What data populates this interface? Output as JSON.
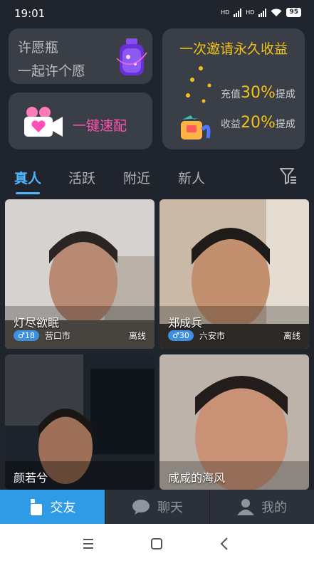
{
  "status_bar": {
    "time": "19:01",
    "network1": "HD",
    "network2": "HD",
    "battery": "95"
  },
  "wish_card": {
    "title": "许愿瓶",
    "subtitle": "一起许个愿"
  },
  "match_card": {
    "label": "一键速配"
  },
  "invite_card": {
    "title": "一次邀请永久收益",
    "recharge_prefix": "充值",
    "recharge_pct": "30%",
    "recharge_suffix": "提成",
    "income_prefix": "收益",
    "income_pct": "20%",
    "income_suffix": "提成"
  },
  "tabs": [
    {
      "label": "真人",
      "active": true
    },
    {
      "label": "活跃"
    },
    {
      "label": "附近"
    },
    {
      "label": "新人"
    }
  ],
  "cards": [
    {
      "name": "灯尽欲眠",
      "age": "18",
      "gender_symbol": "♂",
      "city": "营口市",
      "status": "离线"
    },
    {
      "name": "郑成兵",
      "age": "30",
      "gender_symbol": "♂",
      "city": "六安市",
      "status": "离线"
    },
    {
      "name": "颜若兮"
    },
    {
      "name": "咸咸的海风"
    }
  ],
  "bottom_nav": [
    {
      "label": "交友",
      "active": true
    },
    {
      "label": "聊天"
    },
    {
      "label": "我的"
    }
  ],
  "colors": {
    "accent": "#4fb6ff",
    "gold": "#f2c21a",
    "pink": "#ff4fb4",
    "nav_active": "#2f9ae6"
  }
}
